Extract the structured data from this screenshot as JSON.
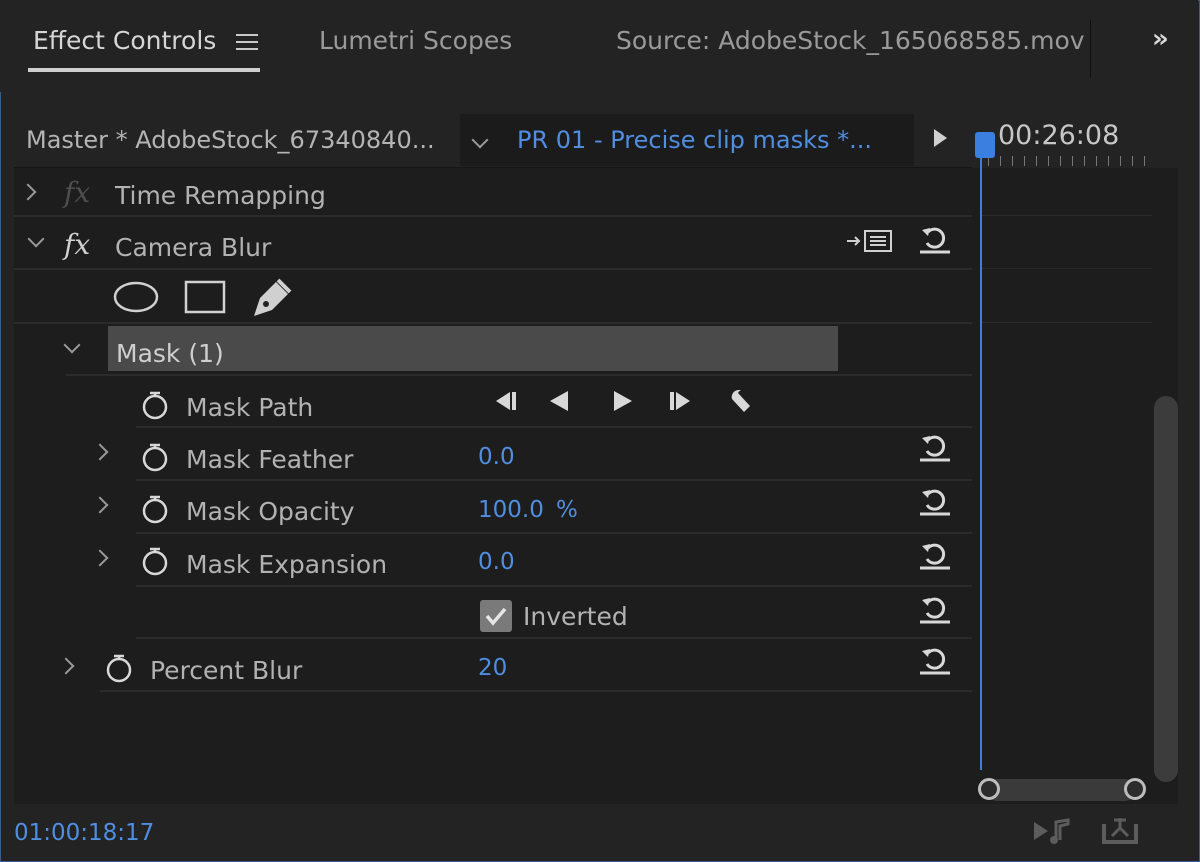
{
  "tabs": [
    {
      "label": "Effect Controls",
      "active": true
    },
    {
      "label": "Lumetri Scopes",
      "active": false
    },
    {
      "label": "Source: AdobeStock_165068585.mov",
      "active": false
    }
  ],
  "overflow_label": "»",
  "header": {
    "master_label": "Master * AdobeStock_67340840...",
    "sequence_label": "PR 01 - Precise clip masks *..."
  },
  "timeline": {
    "timecode": "00:26:08"
  },
  "effects": {
    "time_remapping": "Time Remapping",
    "camera_blur": "Camera Blur",
    "mask_title": "Mask (1)",
    "mask_path": "Mask Path",
    "mask_feather": {
      "label": "Mask Feather",
      "value": "0.0"
    },
    "mask_opacity": {
      "label": "Mask Opacity",
      "value": "100.0",
      "unit": "%"
    },
    "mask_expansion": {
      "label": "Mask Expansion",
      "value": "0.0"
    },
    "inverted": {
      "label": "Inverted",
      "checked": true
    },
    "percent_blur": {
      "label": "Percent Blur",
      "value": "20"
    }
  },
  "footer": {
    "timecode": "01:00:18:17"
  },
  "colors": {
    "accent_blue": "#4f8ee0",
    "panel_border": "#3a5d8f"
  }
}
